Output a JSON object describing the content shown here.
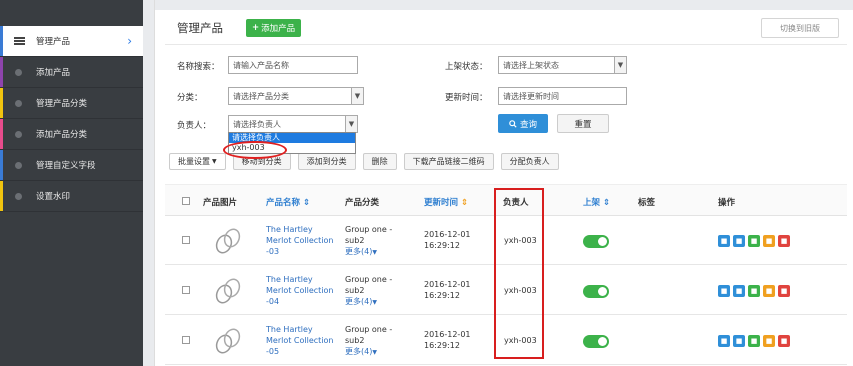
{
  "sidebar": {
    "items": [
      {
        "label": "管理产品",
        "color": "#3a7bd5"
      },
      {
        "label": "添加产品",
        "color": "#8e44ad"
      },
      {
        "label": "管理产品分类",
        "color": "#f1c40f"
      },
      {
        "label": "添加产品分类",
        "color": "#e74c8c"
      },
      {
        "label": "管理自定义字段",
        "color": "#3a7bd5"
      },
      {
        "label": "设置水印",
        "color": "#f1c40f"
      }
    ],
    "active_chevron": "›"
  },
  "header": {
    "title": "管理产品",
    "add_button": "添加产品",
    "switch_button": "切换到旧版"
  },
  "filters": {
    "name_label": "名称搜索：",
    "name_placeholder": "请输入产品名称",
    "status_label": "上架状态：",
    "status_value": "请选择上架状态",
    "category_label": "分类：",
    "category_value": "请选择产品分类",
    "updated_label": "更新时间：",
    "updated_placeholder": "请选择更新时间",
    "owner_label": "负责人：",
    "owner_value": "请选择负责人",
    "owner_options": [
      "请选择负责人",
      "yxh-003"
    ],
    "search_button": "查询",
    "reset_button": "重置"
  },
  "toolbar": {
    "batch": "批量设置",
    "move_category": "移动到分类",
    "add_category": "添加到分类",
    "delete": "删除",
    "download_qr": "下载产品链接二维码",
    "assign_owner": "分配负责人"
  },
  "table": {
    "headers": {
      "image": "产品图片",
      "name": "产品名称",
      "category": "产品分类",
      "updated": "更新时间",
      "owner": "负责人",
      "listed": "上架",
      "tags": "标签",
      "actions": "操作"
    },
    "rows": [
      {
        "name_l1": "The Hartley",
        "name_l2": "Merlot Collection",
        "name_l3": "-03",
        "cat_l1": "Group one -",
        "cat_l2": "sub2",
        "more": "更多(4)",
        "date": "2016-12-01",
        "time": "16:29:12",
        "owner": "yxh-003",
        "listed": true
      },
      {
        "name_l1": "The Hartley",
        "name_l2": "Merlot Collection",
        "name_l3": "-04",
        "cat_l1": "Group one -",
        "cat_l2": "sub2",
        "more": "更多(4)",
        "date": "2016-12-01",
        "time": "16:29:12",
        "owner": "yxh-003",
        "listed": true
      },
      {
        "name_l1": "The Hartley",
        "name_l2": "Merlot Collection",
        "name_l3": "-05",
        "cat_l1": "Group one -",
        "cat_l2": "sub2",
        "more": "更多(4)",
        "date": "2016-12-01",
        "time": "16:29:12",
        "owner": "yxh-003",
        "listed": true
      }
    ],
    "action_colors": [
      "#2f8fd8",
      "#2f8fd8",
      "#3cb24a",
      "#f0a020",
      "#e0443e"
    ],
    "action_icons": [
      "edit-icon",
      "copy-icon",
      "view-icon",
      "share-icon",
      "delete-icon"
    ]
  },
  "annotations": {
    "highlight_color": "#d81e1e"
  }
}
